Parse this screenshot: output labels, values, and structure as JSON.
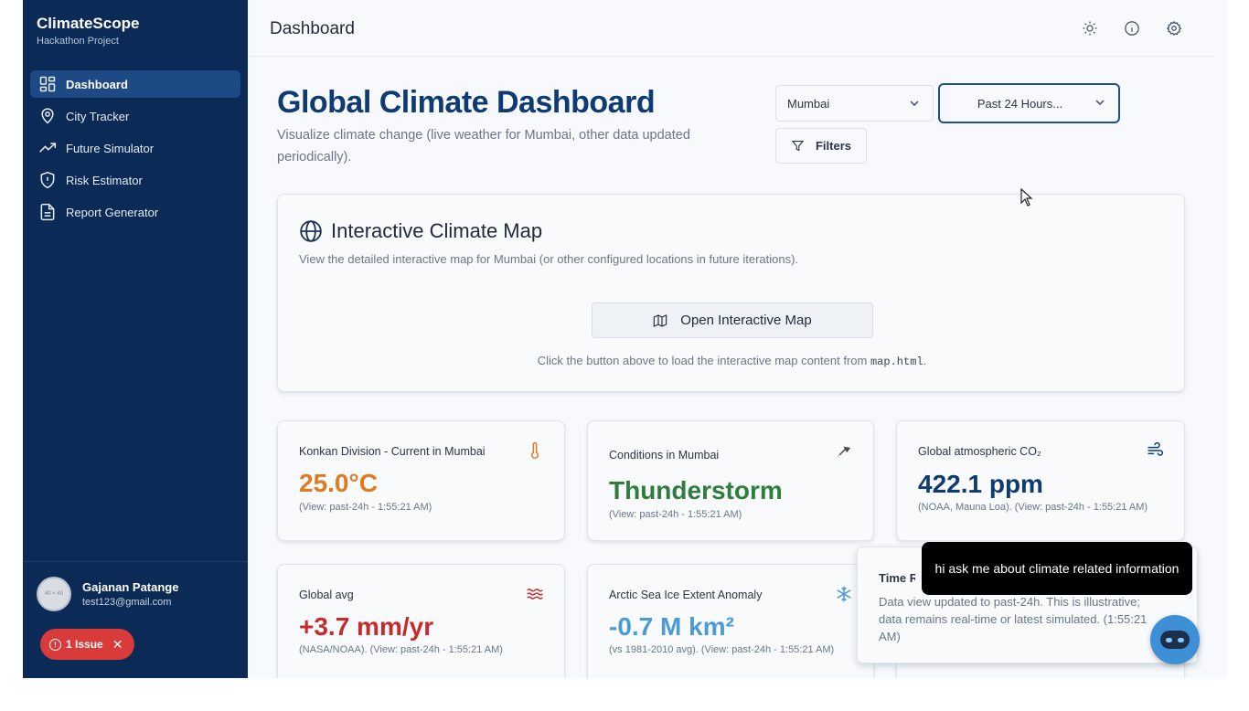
{
  "brand": {
    "title": "ClimateScope",
    "subtitle": "Hackathon Project"
  },
  "sidebar": {
    "items": [
      {
        "label": "Dashboard",
        "icon": "dashboard-grid-icon",
        "active": true
      },
      {
        "label": "City Tracker",
        "icon": "map-pin-icon"
      },
      {
        "label": "Future Simulator",
        "icon": "trending-up-icon"
      },
      {
        "label": "Risk Estimator",
        "icon": "shield-alert-icon"
      },
      {
        "label": "Report Generator",
        "icon": "file-text-icon"
      }
    ]
  },
  "user": {
    "avatar_text": "40 × 40",
    "name": "Gajanan Patange",
    "email": "test123@gmail.com"
  },
  "issue_badge": {
    "label": "1 Issue"
  },
  "header": {
    "title": "Dashboard",
    "icons": [
      "sun-icon",
      "info-icon",
      "settings-icon"
    ]
  },
  "page": {
    "title": "Global Climate Dashboard",
    "subtitle": "Visualize climate change (live weather for Mumbai, other data updated periodically)."
  },
  "controls": {
    "city_select": "Mumbai",
    "range_select": "Past 24 Hours...",
    "filters_label": "Filters"
  },
  "map_card": {
    "title": "Interactive Climate Map",
    "description": "View the detailed interactive map for Mumbai (or other configured locations in future iterations).",
    "button_label": "Open Interactive Map",
    "hint_before": "Click the button above to load the interactive map content from",
    "hint_code": "map.html",
    "hint_after": "."
  },
  "stats": [
    {
      "label": "Konkan Division - Current in Mumbai",
      "value": "25.0°C",
      "note": "(View: past-24h - 1:55:21 AM)",
      "color": "#e07a1f",
      "icon": "thermometer-icon"
    },
    {
      "label": "Conditions in Mumbai",
      "value": "Thunderstorm",
      "note": "(View: past-24h - 1:55:21 AM)",
      "color": "#2e7d3c",
      "icon": "weather-icon"
    },
    {
      "label": "Global atmospheric CO₂",
      "value": "422.1 ppm",
      "note": "(NOAA, Mauna Loa). (View: past-24h - 1:55:21 AM)",
      "color": "#0f3b73",
      "icon": "wind-icon"
    },
    {
      "label": "Global avg",
      "value": "+3.7 mm/yr",
      "note": "(NASA/NOAA). (View: past-24h - 1:55:21 AM)",
      "color": "#c72b2b",
      "icon": "waves-icon"
    },
    {
      "label": "Arctic Sea Ice Extent Anomaly",
      "value": "-0.7 M km²",
      "note": "(vs 1981-2010 avg). (View: past-24h - 1:55:21 AM)",
      "color": "#4b9bd8",
      "icon": "snowflake-icon"
    }
  ],
  "toast": {
    "title": "Time Ra",
    "body": "Data view updated to past-24h. This is illustrative; data remains real-time or latest simulated. (1:55:21 AM)"
  },
  "chat": {
    "tooltip": "hi ask me about climate related information"
  }
}
